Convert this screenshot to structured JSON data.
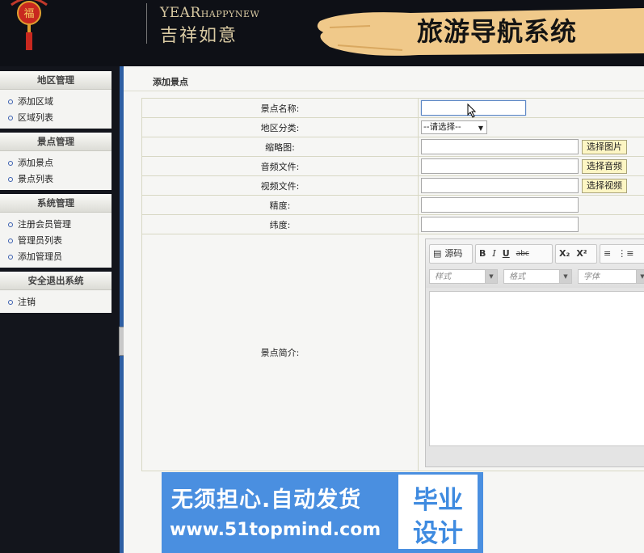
{
  "header": {
    "year_big": "YEAR",
    "year_small": "HAPPYNEW",
    "blessing": "吉祥如意",
    "system_title": "旅游导航系统",
    "lantern_glyph": "福"
  },
  "sidebar": {
    "groups": [
      {
        "title": "地区管理",
        "items": [
          "添加区域",
          "区域列表"
        ]
      },
      {
        "title": "景点管理",
        "items": [
          "添加景点",
          "景点列表"
        ]
      },
      {
        "title": "系统管理",
        "items": [
          "注册会员管理",
          "管理员列表",
          "添加管理员"
        ]
      },
      {
        "title": "安全退出系统",
        "items": [
          "注销"
        ]
      }
    ]
  },
  "main": {
    "page_title": "添加景点",
    "form": {
      "name_label": "景点名称:",
      "region_label": "地区分类:",
      "region_select": "--请选择--",
      "thumb_label": "缩略图:",
      "thumb_button": "选择图片",
      "audio_label": "音频文件:",
      "audio_button": "选择音频",
      "video_label": "视频文件:",
      "video_button": "选择视频",
      "longitude_label": "精度:",
      "latitude_label": "纬度:",
      "intro_label": "景点简介:"
    },
    "editor": {
      "source_label": "源码",
      "bold": "B",
      "italic": "I",
      "underline": "U",
      "strike": "abc",
      "subscript": "X₂",
      "superscript": "X²",
      "style_combo": "样式",
      "format_combo": "格式",
      "font_combo": "字体"
    }
  },
  "watermark": {
    "line1": "无须担心.自动发货",
    "line2": "www.51topmind.com",
    "badge_top": "毕业",
    "badge_bottom": "设计"
  },
  "colors": {
    "accent_blue": "#2e5fa3",
    "button_yellow": "#fdf6c4",
    "watermark_blue": "#4a8fe0"
  }
}
